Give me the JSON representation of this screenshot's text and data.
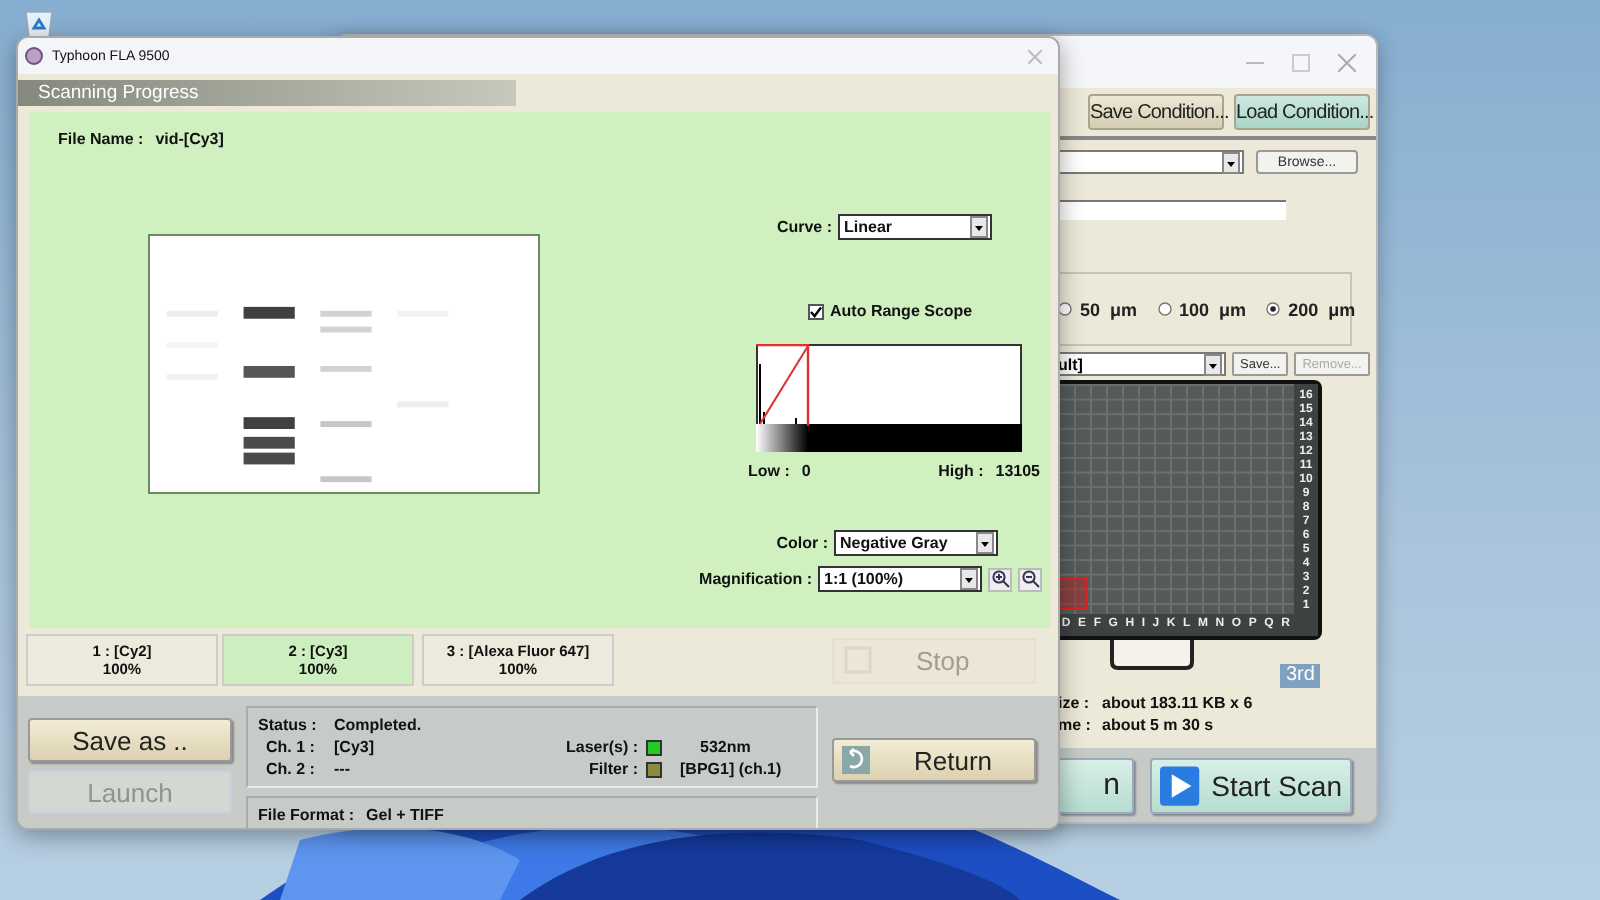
{
  "scan_window": {
    "toolbar_buttons": [
      {
        "label": "Save Condition..."
      },
      {
        "label": "Load Condition..."
      }
    ],
    "browse_button": "Browse...",
    "resolution_options": [
      {
        "label": "50  μm",
        "selected": false
      },
      {
        "label": "100  μm",
        "selected": false
      },
      {
        "label": "200  μm",
        "selected": true
      }
    ],
    "preset": {
      "value": "ult]",
      "buttons": [
        {
          "label": "Save...",
          "disabled": false
        },
        {
          "label": "Remove...",
          "disabled": true
        }
      ]
    },
    "tray": {
      "rows": [
        "16",
        "15",
        "14",
        "13",
        "12",
        "11",
        "10",
        "9",
        "8",
        "7",
        "6",
        "5",
        "4",
        "3",
        "2",
        "1"
      ],
      "columns": [
        "D",
        "E",
        "F",
        "G",
        "H",
        "I",
        "J",
        "K",
        "L",
        "M",
        "N",
        "O",
        "P",
        "Q",
        "R"
      ],
      "badge": "3rd"
    },
    "info": [
      {
        "label": "ize :",
        "value": "about 183.11 KB x 6"
      },
      {
        "label": "me :",
        "value": "about 5 m 30 s"
      }
    ],
    "buttons": [
      {
        "label": "n",
        "kind": "plain"
      },
      {
        "label": "Start Scan",
        "kind": "start"
      }
    ]
  },
  "progress_window": {
    "title": "Typhoon FLA 9500",
    "header": "Scanning Progress",
    "file_name": {
      "label": "File Name :",
      "value": "vid-[Cy3]"
    },
    "curve": {
      "label": "Curve :",
      "value": "Linear"
    },
    "auto_range": {
      "label": "Auto Range Scope",
      "checked": true
    },
    "histogram": {
      "low_label": "Low :",
      "low": "0",
      "high_label": "High :",
      "high": "13105"
    },
    "color": {
      "label": "Color :",
      "value": "Negative Gray"
    },
    "magnification": {
      "label": "Magnification :",
      "value": "1:1 (100%)"
    },
    "channels": [
      {
        "name": "1 : [Cy2]",
        "progress": "100%",
        "selected": false
      },
      {
        "name": "2 : [Cy3]",
        "progress": "100%",
        "selected": true
      },
      {
        "name": "3 : [Alexa Fluor 647]",
        "progress": "100%",
        "selected": false
      }
    ],
    "stop": {
      "label": "Stop",
      "disabled": true
    },
    "save_as": {
      "label": "Save as ..",
      "disabled": false
    },
    "launch": {
      "label": "Launch",
      "disabled": true
    },
    "status": {
      "label": "Status :",
      "value": "Completed.",
      "channels": [
        {
          "label": "Ch. 1 :",
          "value": "[Cy3]"
        },
        {
          "label": "Ch. 2 :",
          "value": "---"
        }
      ],
      "indicators": [
        {
          "label": "Laser(s) :",
          "value": "532nm",
          "color": "#22cc22"
        },
        {
          "label": "Filter :",
          "value": "[BPG1] (ch.1)",
          "color": "#8a8a40"
        }
      ]
    },
    "file_format": {
      "label": "File Format :",
      "value": "Gel + TIFF"
    },
    "return_button": "Return"
  }
}
